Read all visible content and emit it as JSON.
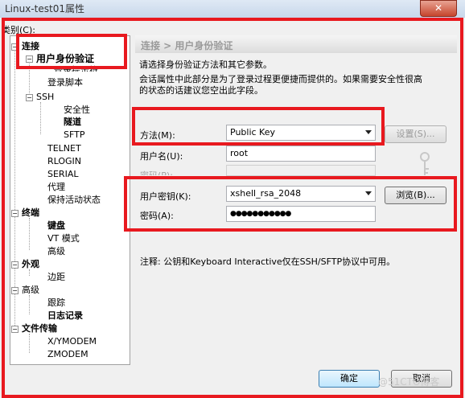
{
  "window": {
    "title": "Linux-test01属性",
    "close_label": "✕"
  },
  "category_label": "类别(C):",
  "tree": {
    "connection": "连接",
    "user_auth": "用户身份验证",
    "login_prompts": "登录提示符",
    "login_script": "登录脚本",
    "ssh": "SSH",
    "security": "安全性",
    "tunnel": "隧道",
    "sftp": "SFTP",
    "telnet": "TELNET",
    "rlogin": "RLOGIN",
    "serial": "SERIAL",
    "proxy": "代理",
    "keepalive": "保持活动状态",
    "terminal": "终端",
    "keyboard": "键盘",
    "vt_mode": "VT 模式",
    "advanced_t": "高级",
    "appearance": "外观",
    "margin": "边距",
    "advanced": "高级",
    "trace": "跟踪",
    "logging": "日志记录",
    "file_transfer": "文件传输",
    "xymodem": "X/YMODEM",
    "zmodem": "ZMODEM",
    "minus": "−",
    "plus": "+"
  },
  "panel": {
    "breadcrumb": "连接 > 用户身份验证",
    "desc1": "请选择身份验证方法和其它参数。",
    "desc2": "会话属性中此部分是为了登录过程更便捷而提供的。如果需要安全性很高",
    "desc3": "的状态的话建议您空出此字段。",
    "method_label": "方法(M):",
    "method_value": "Public Key",
    "settings_button": "设置(S)...",
    "username_label": "用户名(U):",
    "username_value": "root",
    "password_label_top": "密码(P):",
    "userkey_label": "用户密钥(K):",
    "userkey_value": "xshell_rsa_2048",
    "browse_button": "浏览(B)...",
    "passphrase_label": "密码(A):",
    "passphrase_value": "●●●●●●●●●●●",
    "note": "注释: 公钥和Keyboard Interactive仅在SSH/SFTP协议中可用。",
    "ok_button": "确定",
    "cancel_button": "取消"
  },
  "watermark": "@51CTO博客",
  "colors": {
    "highlight": "#e8191f",
    "accent": "#3c7fb1"
  }
}
